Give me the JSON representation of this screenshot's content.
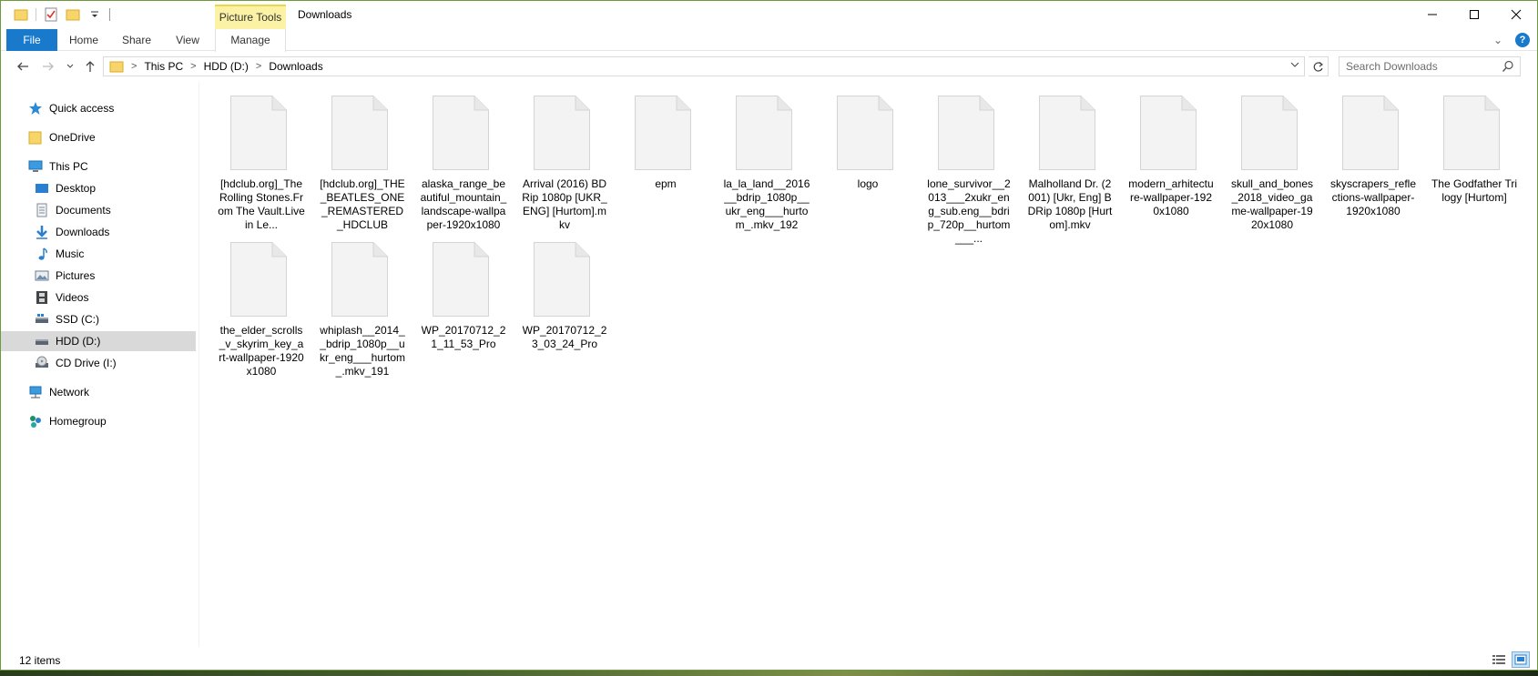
{
  "titlebar": {
    "context_tab": "Picture Tools",
    "title": "Downloads",
    "minimize_glyph": "—",
    "maximize_glyph": "☐",
    "close_glyph": "✕"
  },
  "ribbon": {
    "tabs": [
      "File",
      "Home",
      "Share",
      "View",
      "Manage"
    ],
    "help_glyph": "?",
    "expand_glyph": "⌄"
  },
  "address": {
    "crumbs": [
      "This PC",
      "HDD (D:)",
      "Downloads"
    ],
    "separator": ">",
    "search_placeholder": "Search Downloads"
  },
  "sidebar": {
    "items": [
      {
        "label": "Quick access",
        "icon": "star-icon"
      },
      {
        "label": "OneDrive",
        "icon": "folder-icon"
      },
      {
        "label": "This PC",
        "icon": "computer-icon"
      },
      {
        "label": "Desktop",
        "icon": "desktop-icon"
      },
      {
        "label": "Documents",
        "icon": "documents-icon"
      },
      {
        "label": "Downloads",
        "icon": "download-arrow-icon"
      },
      {
        "label": "Music",
        "icon": "music-note-icon"
      },
      {
        "label": "Pictures",
        "icon": "pictures-icon"
      },
      {
        "label": "Videos",
        "icon": "film-icon"
      },
      {
        "label": "SSD (C:)",
        "icon": "drive-icon"
      },
      {
        "label": "HDD (D:)",
        "icon": "drive-icon"
      },
      {
        "label": "CD Drive (I:)",
        "icon": "cd-drive-icon"
      },
      {
        "label": "Network",
        "icon": "network-icon"
      },
      {
        "label": "Homegroup",
        "icon": "homegroup-icon"
      }
    ],
    "selected": "HDD (D:)"
  },
  "files": [
    {
      "name": "[hdclub.org]_The Rolling Stones.From The Vault.Live in Le..."
    },
    {
      "name": "[hdclub.org]_THE_BEATLES_ONE_REMASTERED_HDCLUB"
    },
    {
      "name": "alaska_range_beautiful_mountain_landscape-wallpaper-1920x1080"
    },
    {
      "name": "Arrival (2016) BDRip 1080p [UKR_ENG] [Hurtom].mkv"
    },
    {
      "name": "epm"
    },
    {
      "name": "la_la_land__2016__bdrip_1080p__ukr_eng___hurtom_.mkv_192"
    },
    {
      "name": "logo"
    },
    {
      "name": "lone_survivor__2013___2xukr_eng_sub.eng__bdrip_720p__hurtom___..."
    },
    {
      "name": "Malholland Dr. (2001) [Ukr, Eng] BDRip 1080p [Hurtom].mkv"
    },
    {
      "name": "modern_arhitecture-wallpaper-1920x1080"
    },
    {
      "name": "skull_and_bones_2018_video_game-wallpaper-1920x1080"
    },
    {
      "name": "skyscrapers_reflections-wallpaper-1920x1080"
    },
    {
      "name": "The Godfather Trilogy [Hurtom]"
    },
    {
      "name": "the_elder_scrolls_v_skyrim_key_art-wallpaper-1920x1080"
    },
    {
      "name": "whiplash__2014__bdrip_1080p__ukr_eng___hurtom_.mkv_191"
    },
    {
      "name": "WP_20170712_21_11_53_Pro"
    },
    {
      "name": "WP_20170712_23_03_24_Pro"
    }
  ],
  "status": {
    "item_count": "12 items"
  }
}
